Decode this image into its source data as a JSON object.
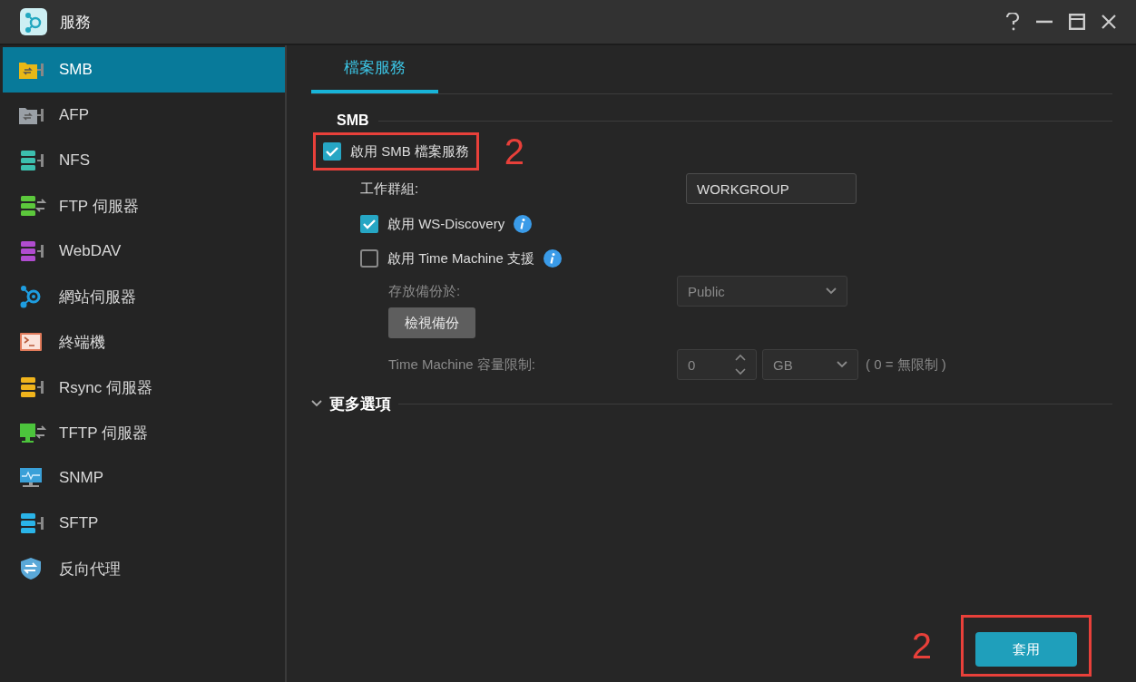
{
  "window": {
    "title": "服務"
  },
  "sidebar": {
    "items": [
      {
        "label": "SMB",
        "kind": "folder",
        "color": "#e8b816",
        "selected": true
      },
      {
        "label": "AFP",
        "kind": "folder",
        "color": "#9aa0a6",
        "selected": false
      },
      {
        "label": "NFS",
        "kind": "stack",
        "color": "#3cbfae",
        "selected": false
      },
      {
        "label": "FTP 伺服器",
        "kind": "stack-arrows",
        "color": "#5cc83c",
        "selected": false
      },
      {
        "label": "WebDAV",
        "kind": "stack",
        "color": "#b04cd0",
        "selected": false
      },
      {
        "label": "網站伺服器",
        "kind": "network",
        "color": "#1e9de0",
        "selected": false
      },
      {
        "label": "終端機",
        "kind": "terminal",
        "color": "#e07a5a",
        "selected": false
      },
      {
        "label": "Rsync 伺服器",
        "kind": "stack",
        "color": "#f0b41c",
        "selected": false
      },
      {
        "label": "TFTP 伺服器",
        "kind": "screen-arrows",
        "color": "#4cc43c",
        "selected": false
      },
      {
        "label": "SNMP",
        "kind": "monitor",
        "color": "#3aa0d8",
        "selected": false
      },
      {
        "label": "SFTP",
        "kind": "stack",
        "color": "#2ab4e8",
        "selected": false
      },
      {
        "label": "反向代理",
        "kind": "shield",
        "color": "#5aa8d8",
        "selected": false
      }
    ]
  },
  "tabs": [
    {
      "label": "檔案服務",
      "selected": true
    }
  ],
  "smb": {
    "heading": "SMB",
    "enable": {
      "label": "啟用 SMB 檔案服務",
      "checked": true,
      "highlighted": true,
      "annotation": "2"
    },
    "workgroup": {
      "label": "工作群組:",
      "value": "WORKGROUP"
    },
    "options": [
      {
        "label": "啟用 WS-Discovery",
        "checked": true
      },
      {
        "label": "啟用 Time Machine 支援",
        "checked": false
      }
    ],
    "time_machine": {
      "disabled": true,
      "location_label": "存放備份於:",
      "location": "Public",
      "view_button": "檢視備份",
      "limit_label": "Time Machine 容量限制:",
      "limit_value": "0",
      "unit": "GB",
      "limit_hint": "( 0 = 無限制 )"
    }
  },
  "more_options": {
    "label": "更多選項"
  },
  "apply": {
    "label": "套用",
    "highlighted": true,
    "annotation": "2"
  }
}
